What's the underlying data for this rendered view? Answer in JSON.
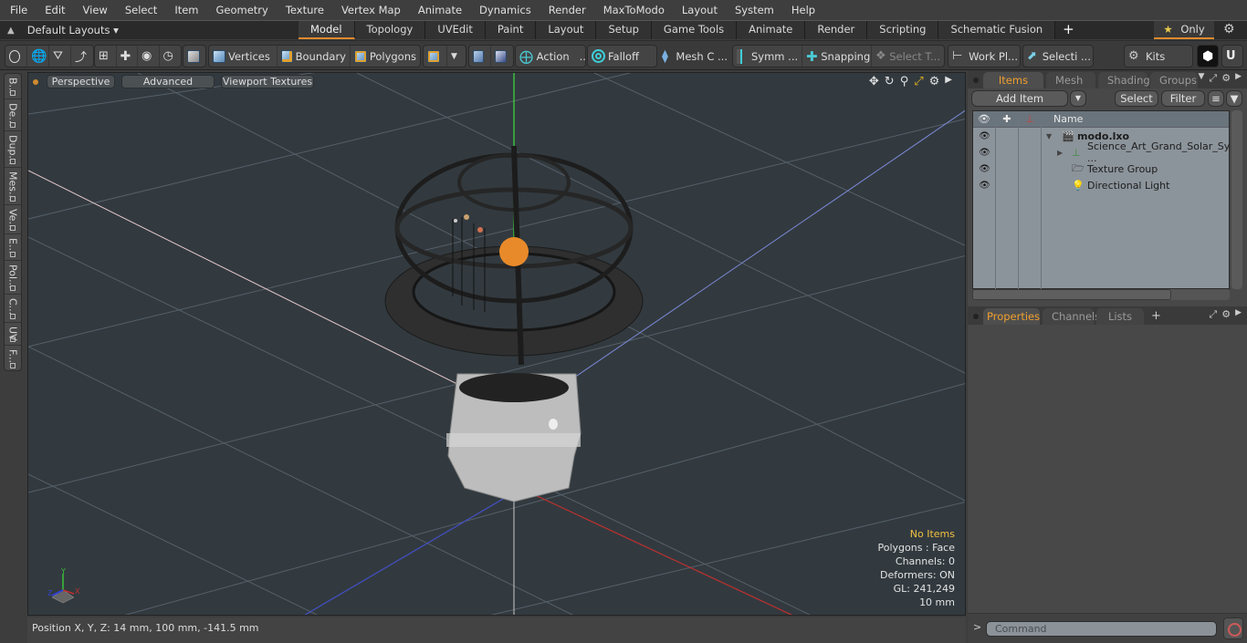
{
  "menubar": [
    "File",
    "Edit",
    "View",
    "Select",
    "Item",
    "Geometry",
    "Texture",
    "Vertex Map",
    "Animate",
    "Dynamics",
    "Render",
    "MaxToModo",
    "Layout",
    "System",
    "Help"
  ],
  "layouts": {
    "label": "Default Layouts ▾"
  },
  "mode_tabs": [
    {
      "label": "Model",
      "active": true
    },
    {
      "label": "Topology"
    },
    {
      "label": "UVEdit"
    },
    {
      "label": "Paint"
    },
    {
      "label": "Layout"
    },
    {
      "label": "Setup"
    },
    {
      "label": "Game Tools"
    },
    {
      "label": "Animate"
    },
    {
      "label": "Render"
    },
    {
      "label": "Scripting"
    },
    {
      "label": "Schematic Fusion"
    }
  ],
  "mode_add": "+",
  "only_button": {
    "star": "★",
    "label": "Only"
  },
  "toolbar": {
    "vertices": "Vertices",
    "boundary": "Boundary",
    "polygons": "Polygons",
    "action": "Action",
    "action_more": "...",
    "falloff": "Falloff",
    "mesh_c": "Mesh C ...",
    "symm": "Symm ...",
    "snapping": "Snapping",
    "select_t": "Select T...",
    "work_pl": "Work Pl...",
    "selecti": "Selecti ...",
    "kits": "Kits"
  },
  "left_tabs": [
    "B...",
    "De...",
    "Dup...",
    "Mes...",
    "Ve...",
    "E...",
    "Pol...",
    "C...",
    "UV",
    "F..."
  ],
  "viewport": {
    "perspective": "Perspective",
    "advanced": "Advanced",
    "viewport_textures": "Viewport Textures",
    "info": {
      "selection": "No Items",
      "polygons": "Polygons : Face",
      "channels": "Channels: 0",
      "deformers": "Deformers: ON",
      "gl": "GL: 241,249",
      "scale": "10 mm"
    },
    "axis_labels": {
      "x": "X",
      "y": "Y",
      "z": "Z"
    }
  },
  "status": {
    "position": "Position X, Y, Z:   14 mm, 100 mm, -141.5 mm"
  },
  "items_panel": {
    "tabs": [
      {
        "label": "Items",
        "active": true
      },
      {
        "label": "Mesh ..."
      },
      {
        "label": "Shading"
      },
      {
        "label": "Groups"
      }
    ],
    "add_item": "Add Item",
    "select": "Select",
    "filter": "Filter",
    "name_header": "Name",
    "tree": [
      {
        "name": "modo.lxo",
        "level": 0,
        "expanded": true,
        "bold": true
      },
      {
        "name": "Science_Art_Grand_Solar_Sy ...",
        "level": 1,
        "collapsed": true
      },
      {
        "name": "Texture Group",
        "level": 1
      },
      {
        "name": "Directional Light",
        "level": 1
      }
    ]
  },
  "properties_panel": {
    "tabs": [
      {
        "label": "Properties",
        "active": true
      },
      {
        "label": "Channels"
      },
      {
        "label": "Lists"
      }
    ],
    "add": "+"
  },
  "command": {
    "placeholder": "Command",
    "prompt": ">"
  }
}
